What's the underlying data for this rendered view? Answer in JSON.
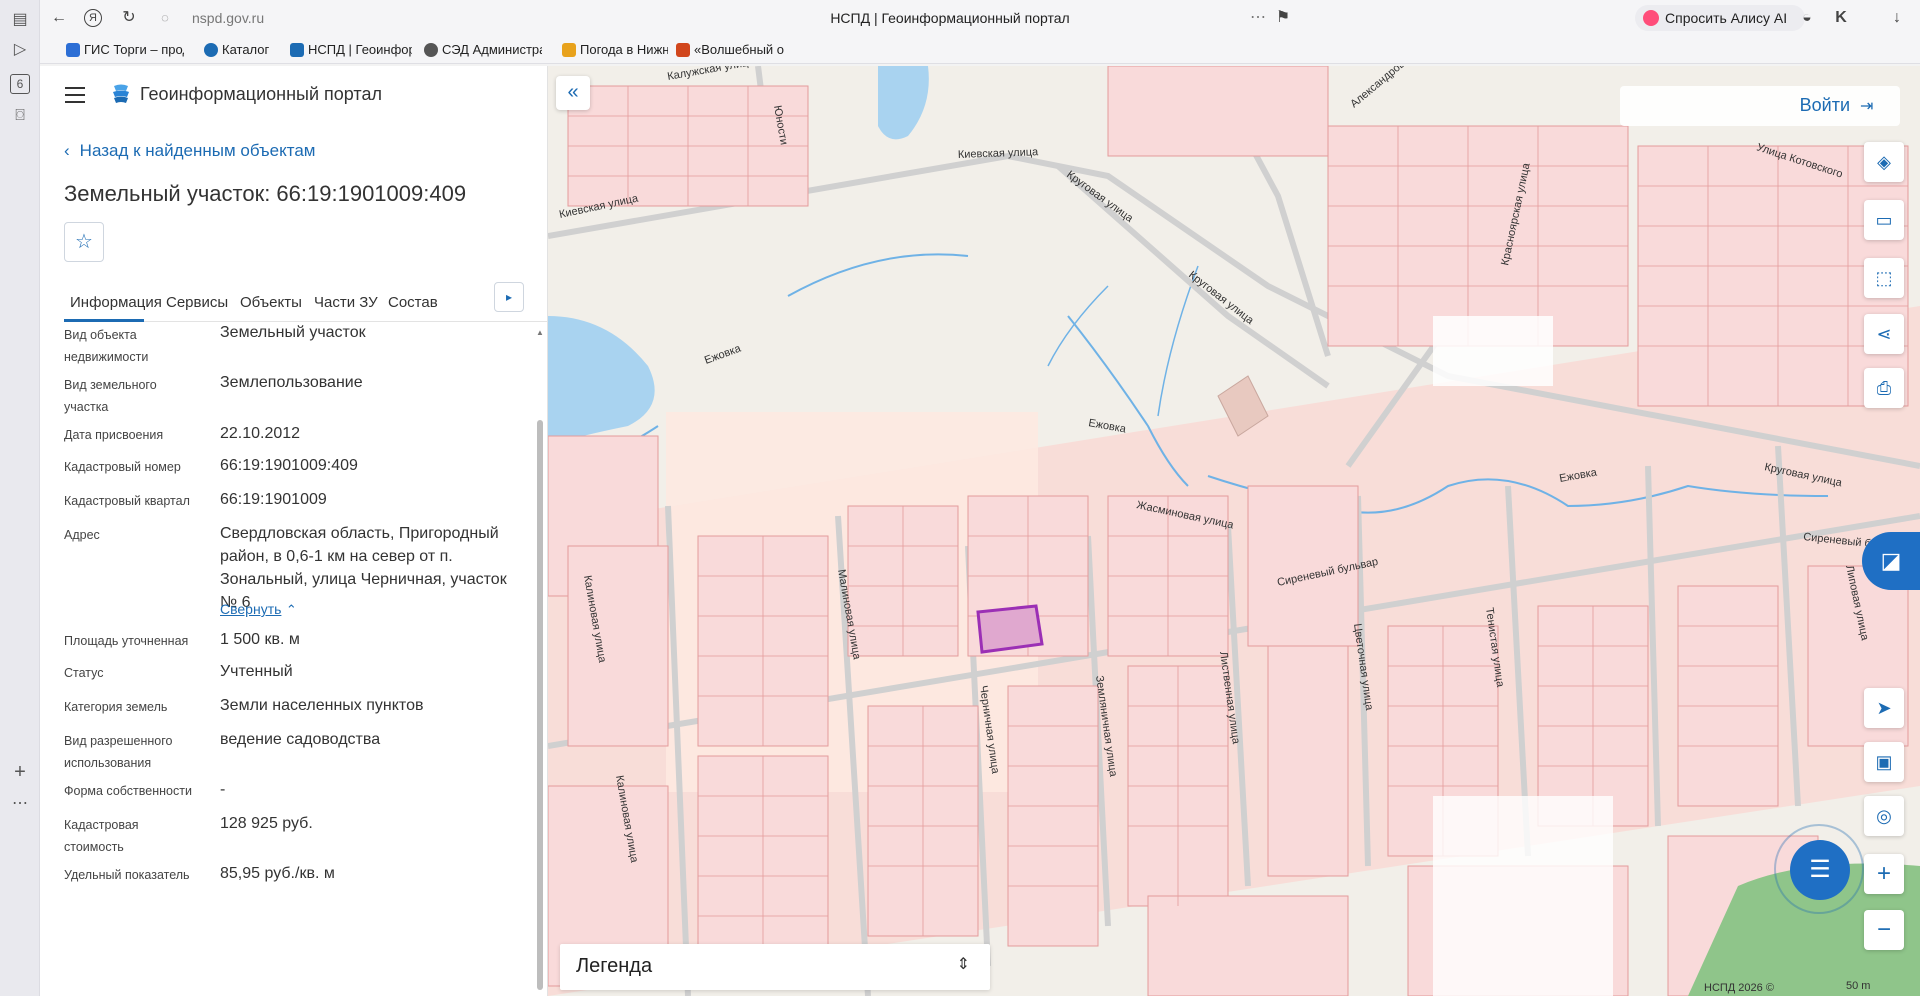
{
  "browser": {
    "url": "nspd.gov.ru",
    "page_title": "НСПД | Геоинформационный портал",
    "alice_label": "Спросить Алису AI",
    "rail_badge": "6",
    "bookmarks": [
      {
        "label": "ГИС Торги – прод",
        "color": "#2c6ed5"
      },
      {
        "label": "Каталог",
        "color": "#1c6bb3"
      },
      {
        "label": "НСПД | Геоинфор",
        "color": "#1c6bb3"
      },
      {
        "label": "СЭД Администра",
        "color": "#555555"
      },
      {
        "label": "Погода в Нижнем",
        "color": "#e8a21c"
      },
      {
        "label": "«Волшебный остр",
        "color": "#d1461c"
      }
    ]
  },
  "panel": {
    "portal_title": "Геоинформационный портал",
    "back_label": "Назад к найденным объектам",
    "object_title": "Земельный участок: 66:19:1901009:409",
    "tabs": [
      "Информация",
      "Сервисы",
      "Объекты",
      "Части ЗУ",
      "Состав"
    ],
    "active_tab": "Информация",
    "properties": [
      {
        "label": "Вид объекта недвижимости",
        "value": "Земельный участок"
      },
      {
        "label": "Вид земельного участка",
        "value": "Землепользование"
      },
      {
        "label": "Дата присвоения",
        "value": "22.10.2012"
      },
      {
        "label": "Кадастровый номер",
        "value": "66:19:1901009:409"
      },
      {
        "label": "Кадастровый квартал",
        "value": "66:19:1901009"
      },
      {
        "label": "Адрес",
        "value": "Свердловская область, Пригородный район, в 0,6-1 км на север от п. Зональный, улица Черничная, участок № 6"
      },
      {
        "label": "Площадь уточненная",
        "value": "1 500 кв. м"
      },
      {
        "label": "Статус",
        "value": "Учтенный"
      },
      {
        "label": "Категория земель",
        "value": "Земли населенных пунктов"
      },
      {
        "label": "Вид разрешенного использования",
        "value": "ведение садоводства"
      },
      {
        "label": "Форма собственности",
        "value": "-"
      },
      {
        "label": "Кадастровая стоимость",
        "value": "128 925 руб."
      },
      {
        "label": "Удельный показатель",
        "value": "85,95 руб./кв. м"
      }
    ],
    "collapse_label": "Свернуть"
  },
  "map": {
    "login_label": "Войти",
    "legend_label": "Легенда",
    "copyright": "НСПД 2026 ©",
    "scale_label": "50 m",
    "streets": {
      "kaluzhskaya": "Калужская улица",
      "kievskaya_1": "Киевская улица",
      "kievskaya_2": "Киевская улица",
      "krugovaya_1": "Круговая улица",
      "krugovaya_2": "Круговая улица",
      "krugovaya_3": "Круговая улица",
      "yasminovaya": "Жасминовая улица",
      "sirenevy_1": "Сиреневый бульвар",
      "sirenevy_2": "Сиреневый бульвар",
      "kalinovaya_1": "Калиновая улица",
      "kalinovaya_2": "Калиновая улица",
      "malinovaya": "Малиновая улица",
      "chernichnaya": "Черничная улица",
      "zemlyanichnaya": "Земляничная улица",
      "listvennaya": "Лиственная улица",
      "tsvetochnaya": "Цветочная улица",
      "tenistaya": "Тенистая улица",
      "lipovaya": "Липовая улица",
      "kotovskogo": "Улица Котовского",
      "krasnoyarskaya": "Красноярская улица",
      "ezhovka_1": "Ежовка",
      "ezhovka_2": "Ежовка",
      "ezhovka_3": "Ежовка",
      "yunosti": "Юности",
      "aleksandrovskaya": "Александровская"
    },
    "highlight_color": "#9b2fb5",
    "parcel_color": "#f7d6d6",
    "parcel_stroke": "#e08a8a"
  }
}
